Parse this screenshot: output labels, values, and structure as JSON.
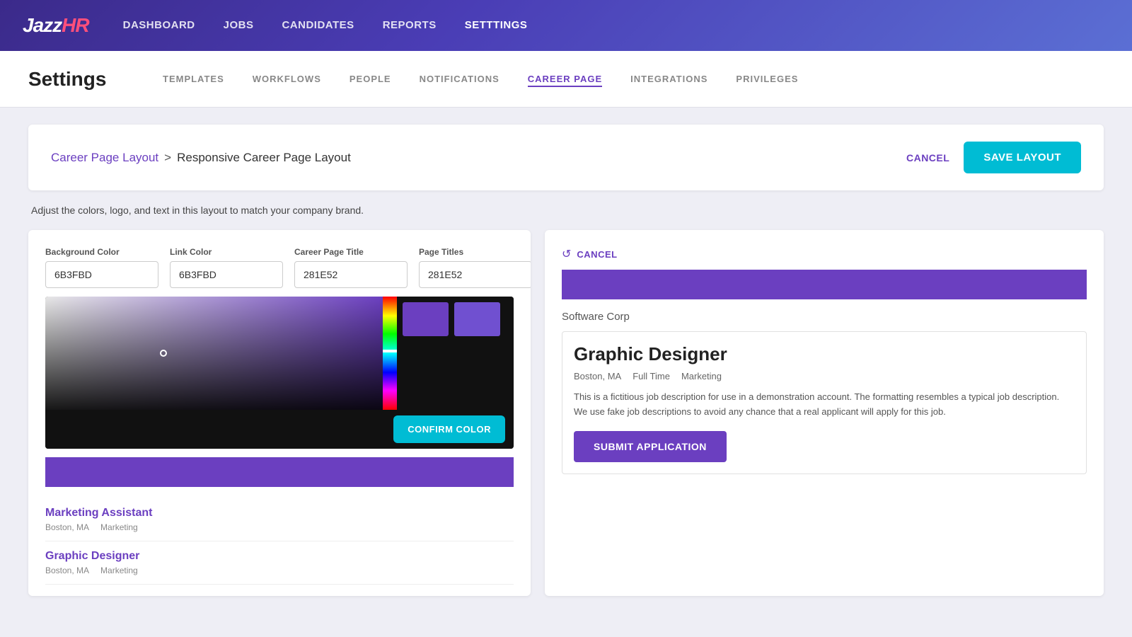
{
  "topNav": {
    "logo": {
      "jazz": "JAZZ",
      "hr": "HR"
    },
    "links": [
      {
        "label": "DASHBOARD",
        "active": false
      },
      {
        "label": "JOBS",
        "active": false
      },
      {
        "label": "CANDIDATES",
        "active": false
      },
      {
        "label": "REPORTS",
        "active": false
      },
      {
        "label": "SETTTINGS",
        "active": true
      }
    ]
  },
  "settingsBar": {
    "title": "Settings",
    "navItems": [
      {
        "label": "TEMPLATES",
        "active": false
      },
      {
        "label": "WORKFLOWS",
        "active": false
      },
      {
        "label": "PEOPLE",
        "active": false
      },
      {
        "label": "NOTIFICATIONS",
        "active": false
      },
      {
        "label": "CAREER PAGE",
        "active": true
      },
      {
        "label": "INTEGRATIONS",
        "active": false
      },
      {
        "label": "PRIVILEGES",
        "active": false
      }
    ]
  },
  "layoutHeader": {
    "breadcrumbLink": "Career Page Layout",
    "separator": ">",
    "currentPage": "Responsive Career Page Layout",
    "cancelLabel": "CANCEL",
    "saveLabel": "SAVE LAYOUT"
  },
  "description": "Adjust the colors, logo, and text in this layout to match your company brand.",
  "colorControls": {
    "backgroundColorLabel": "Background Color",
    "backgroundColorValue": "6B3FBD",
    "linkColorLabel": "Link Color",
    "linkColorValue": "6B3FBD",
    "careerPageTitleLabel": "Career Page Title",
    "careerPageTitleValue": "281E52",
    "pageTitlesLabel": "Page Titles",
    "pageTitlesValue": "281E52",
    "cancelResetLabel": "CANCEL",
    "confirmColorLabel": "CONFIRM COLOR"
  },
  "previewLeft": {
    "jobs": [
      {
        "title": "Marketing Assistant",
        "location": "Boston, MA",
        "department": "Marketing"
      },
      {
        "title": "Graphic Designer",
        "location": "Boston, MA",
        "department": "Marketing"
      }
    ]
  },
  "previewRight": {
    "companyName": "Software Corp",
    "jobTitle": "Graphic Designer",
    "location": "Boston, MA",
    "jobType": "Full Time",
    "department": "Marketing",
    "description": "This is a fictitious job description for use in a demonstration account. The formatting resembles a typical job description. We use fake job descriptions to avoid any chance that a real applicant will apply for this job.",
    "submitLabel": "SUBMIT APPLICATION"
  }
}
